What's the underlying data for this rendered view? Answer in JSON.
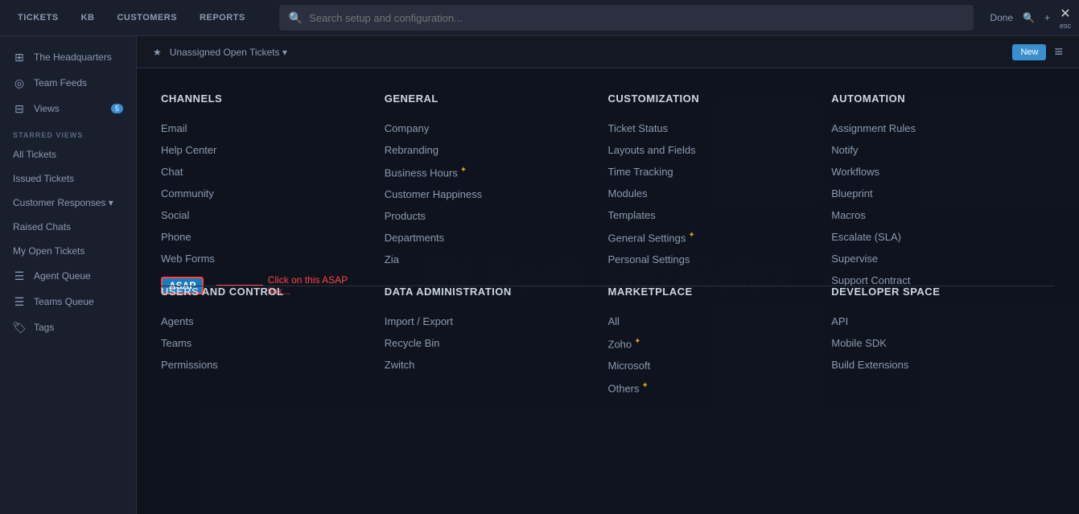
{
  "topnav": {
    "tabs": [
      "TICKETS",
      "KB",
      "CUSTOMERS",
      "REPORTS"
    ],
    "search_placeholder": "Search setup and configuration...",
    "right_items": [
      "Done"
    ],
    "close_label": "esc"
  },
  "sidebar": {
    "items": [
      {
        "icon": "⊞",
        "label": "The Headquarters"
      },
      {
        "icon": "◎",
        "label": "Team Feeds"
      },
      {
        "icon": "⊟",
        "label": "Views"
      },
      {
        "section": "STARRED VIEWS"
      },
      {
        "label": "All Tickets"
      },
      {
        "label": "Issued Tickets"
      },
      {
        "label": "Customer Responses ▾"
      },
      {
        "label": "Raised Chats"
      },
      {
        "label": "My Open Tickets"
      },
      {
        "icon": "☰",
        "label": "Agent Queue"
      },
      {
        "icon": "☰",
        "label": "Teams Queue"
      },
      {
        "icon": "🏷",
        "label": "Tags"
      }
    ]
  },
  "main_header": {
    "title": "Unassigned Open Tickets ▾",
    "button": "New"
  },
  "channels": {
    "heading": "CHANNELS",
    "items": [
      {
        "label": "Email",
        "star": false
      },
      {
        "label": "Help Center",
        "star": false
      },
      {
        "label": "Chat",
        "star": false
      },
      {
        "label": "Community",
        "star": false
      },
      {
        "label": "Social",
        "star": false
      },
      {
        "label": "Phone",
        "star": false
      },
      {
        "label": "Web Forms",
        "star": false
      },
      {
        "label": "ASAP",
        "is_asap": true,
        "arrow_text": "Click on this ASAP link..."
      }
    ]
  },
  "general": {
    "heading": "GENERAL",
    "items": [
      {
        "label": "Company",
        "star": false
      },
      {
        "label": "Rebranding",
        "star": false
      },
      {
        "label": "Business Hours",
        "star": true
      },
      {
        "label": "Customer Happiness",
        "star": false
      },
      {
        "label": "Products",
        "star": false
      },
      {
        "label": "Departments",
        "star": false
      },
      {
        "label": "Zia",
        "star": false
      }
    ]
  },
  "customization": {
    "heading": "CUSTOMIZATION",
    "items": [
      {
        "label": "Ticket Status",
        "star": false
      },
      {
        "label": "Layouts and Fields",
        "star": false
      },
      {
        "label": "Time Tracking",
        "star": false
      },
      {
        "label": "Modules",
        "star": false
      },
      {
        "label": "Templates",
        "star": false
      },
      {
        "label": "General Settings",
        "star": true
      },
      {
        "label": "Personal Settings",
        "star": false
      }
    ]
  },
  "automation": {
    "heading": "AUTOMATION",
    "items": [
      {
        "label": "Assignment Rules",
        "star": false
      },
      {
        "label": "Notify",
        "star": false
      },
      {
        "label": "Workflows",
        "star": false
      },
      {
        "label": "Blueprint",
        "star": false
      },
      {
        "label": "Macros",
        "star": false
      },
      {
        "label": "Escalate (SLA)",
        "star": false
      },
      {
        "label": "Supervise",
        "star": false
      },
      {
        "label": "Support Contract",
        "star": false
      }
    ]
  },
  "users_and_control": {
    "heading": "USERS AND CONTROL",
    "items": [
      {
        "label": "Agents",
        "star": false
      },
      {
        "label": "Teams",
        "star": false
      },
      {
        "label": "Permissions",
        "star": false
      }
    ]
  },
  "data_administration": {
    "heading": "DATA ADMINISTRATION",
    "items": [
      {
        "label": "Import / Export",
        "star": false
      },
      {
        "label": "Recycle Bin",
        "star": false
      },
      {
        "label": "Zwitch",
        "star": false
      }
    ]
  },
  "marketplace": {
    "heading": "MARKETPLACE",
    "items": [
      {
        "label": "All",
        "star": false
      },
      {
        "label": "Zoho",
        "star": true
      },
      {
        "label": "Microsoft",
        "star": false
      },
      {
        "label": "Others",
        "star": true
      }
    ]
  },
  "developer_space": {
    "heading": "DEVELOPER SPACE",
    "items": [
      {
        "label": "API",
        "star": false
      },
      {
        "label": "Mobile SDK",
        "star": false
      },
      {
        "label": "Build Extensions",
        "star": false
      }
    ]
  },
  "ghost_text": "Sit Back and Relax"
}
